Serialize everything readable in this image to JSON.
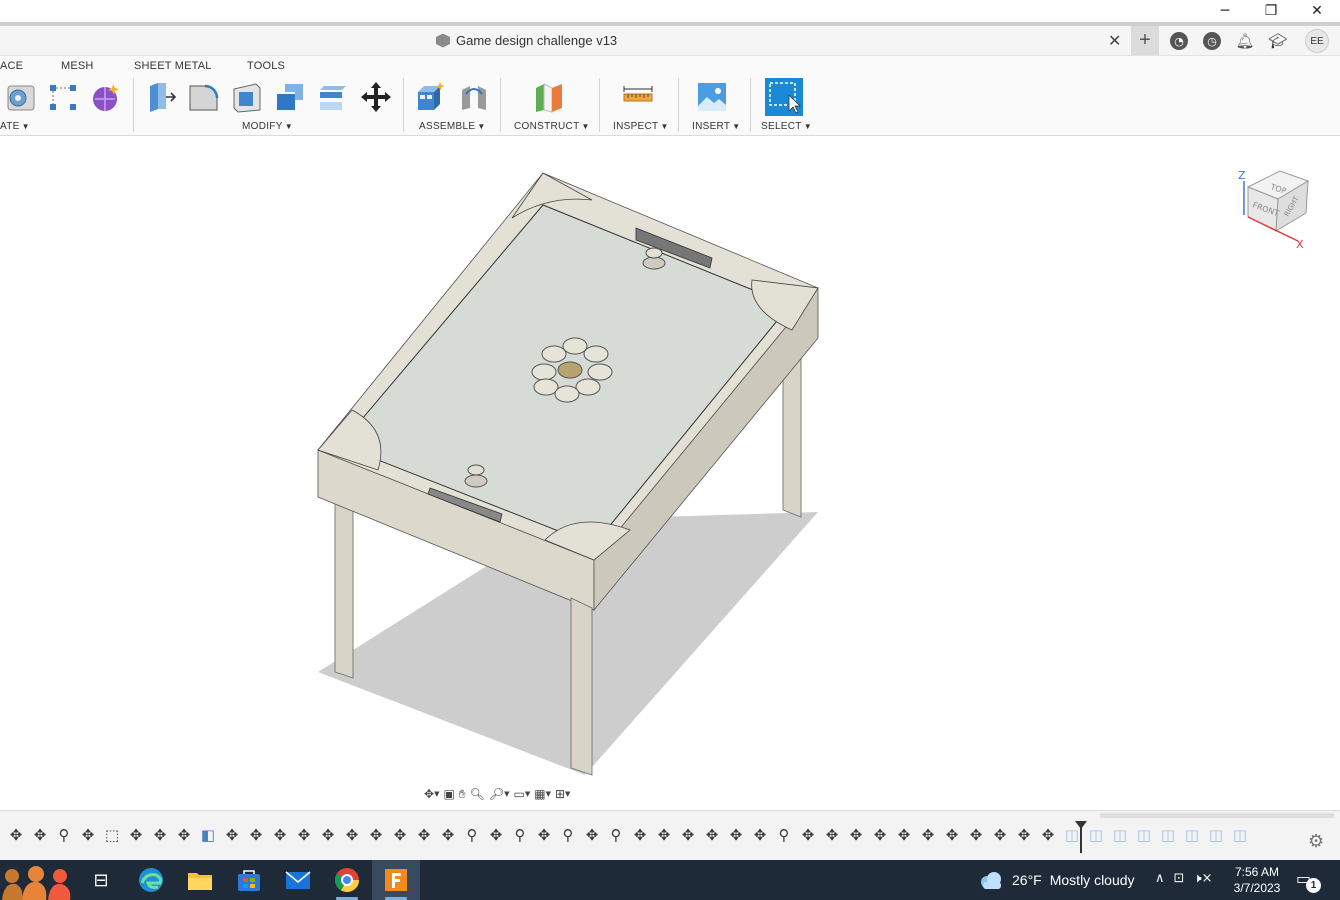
{
  "window": {
    "minimize_glyph": "─",
    "restore_glyph": "❐",
    "close_glyph": "✕"
  },
  "document_tab": {
    "title": "Game design challenge v13",
    "close_glyph": "✕",
    "add_glyph": "+"
  },
  "header_icons": [
    "data-panel-icon",
    "history-icon",
    "notifications-icon",
    "learn-icon"
  ],
  "user": {
    "initials": "EE"
  },
  "ribbon": {
    "tabs": [
      "ACE",
      "MESH",
      "SHEET METAL",
      "TOOLS"
    ],
    "groups": [
      "ATE",
      "MODIFY",
      "ASSEMBLE",
      "CONSTRUCT",
      "INSPECT",
      "INSERT",
      "SELECT"
    ]
  },
  "navbar": {
    "items": [
      "orbit-icon",
      "look-at-icon",
      "pan-icon",
      "zoom-icon",
      "zoom-window-icon",
      "display-settings-icon",
      "grid-settings-icon",
      "viewports-icon"
    ]
  },
  "viewcube": {
    "face_top": "TOP",
    "face_front": "FRONT",
    "face_right": "RIGHT",
    "axis_z": "Z",
    "axis_x": "X"
  },
  "timeline": {
    "item_glyph": "✥",
    "settings_glyph": "⚙"
  },
  "taskbar": {
    "weather_temp": "26°F",
    "weather_text": "Mostly cloudy",
    "time": "7:56 AM",
    "date": "3/7/2023",
    "notification_count": "1",
    "tray_up_glyph": "∧",
    "tray_network_glyph": "⊡",
    "tray_volume_glyph": "🕨"
  },
  "colors": {
    "taskbar_bg": "#1f2a38",
    "select_accent": "#1b8ad6",
    "table_top": "#d6dbd6",
    "table_frame": "#dcd8cc"
  }
}
